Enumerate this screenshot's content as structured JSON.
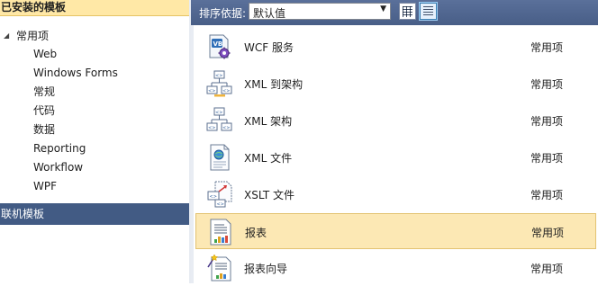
{
  "left_panel": {
    "installed_header": "已安装的模板",
    "tree_root": {
      "label": "常用项",
      "expander": "◢",
      "children": [
        "Web",
        "Windows Forms",
        "常规",
        "代码",
        "数据",
        "Reporting",
        "Workflow",
        "WPF"
      ]
    },
    "online_header": "联机模板"
  },
  "toolbar": {
    "sort_label": "排序依据:",
    "sort_value": "默认值",
    "dropdown_arrow": "▼",
    "view_buttons": [
      "small-icons-view-icon",
      "medium-icons-view-icon"
    ]
  },
  "templates": [
    {
      "name": "WCF 服务",
      "category": "常用项",
      "icon": "wcf-service-icon"
    },
    {
      "name": "XML 到架构",
      "category": "常用项",
      "icon": "xml-to-schema-icon"
    },
    {
      "name": "XML 架构",
      "category": "常用项",
      "icon": "xml-schema-icon"
    },
    {
      "name": "XML 文件",
      "category": "常用项",
      "icon": "xml-file-icon"
    },
    {
      "name": "XSLT 文件",
      "category": "常用项",
      "icon": "xslt-file-icon"
    },
    {
      "name": "报表",
      "category": "常用项",
      "icon": "report-icon",
      "selected": true
    },
    {
      "name": "报表向导",
      "category": "常用项",
      "icon": "report-wizard-icon"
    }
  ],
  "colors": {
    "installed_header_bg": "#ffe8a6",
    "online_header_bg": "#425b84",
    "toolbar_bg": "#4f668f",
    "selected_row_bg": "#fce8b4"
  }
}
